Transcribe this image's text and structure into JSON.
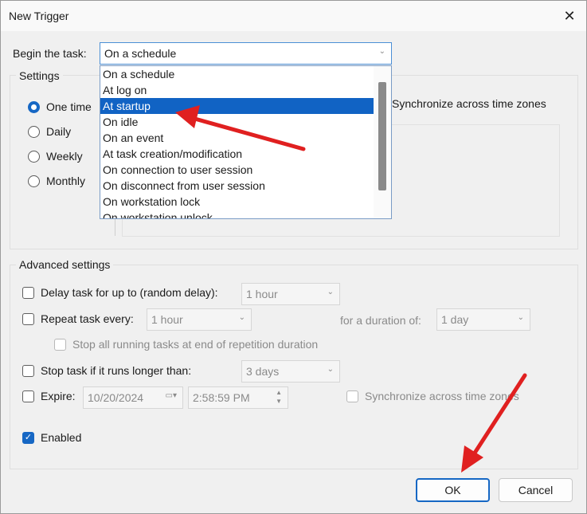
{
  "window": {
    "title": "New Trigger",
    "close_glyph": "✕"
  },
  "begin": {
    "label": "Begin the task:",
    "selected": "On a schedule",
    "options": [
      "On a schedule",
      "At log on",
      "At startup",
      "On idle",
      "On an event",
      "At task creation/modification",
      "On connection to user session",
      "On disconnect from user session",
      "On workstation lock",
      "On workstation unlock"
    ],
    "highlighted_index": 2
  },
  "settings": {
    "title": "Settings",
    "radios": [
      "One time",
      "Daily",
      "Weekly",
      "Monthly"
    ],
    "selected_radio": "One time",
    "sync_label": "Synchronize across time zones"
  },
  "advanced": {
    "title": "Advanced settings",
    "delay_label": "Delay task for up to (random delay):",
    "delay_value": "1 hour",
    "repeat_label": "Repeat task every:",
    "repeat_value": "1 hour",
    "duration_label": "for a duration of:",
    "duration_value": "1 day",
    "stop_all_label": "Stop all running tasks at end of repetition duration",
    "stop_label": "Stop task if it runs longer than:",
    "stop_value": "3 days",
    "expire_label": "Expire:",
    "expire_date": "10/20/2024",
    "expire_time": "2:58:59 PM",
    "expire_sync_label": "Synchronize across time zones",
    "enabled_label": "Enabled",
    "enabled_checked": true
  },
  "buttons": {
    "ok": "OK",
    "cancel": "Cancel"
  },
  "colors": {
    "accent": "#1667c4",
    "annotation_arrow": "#e02020"
  }
}
